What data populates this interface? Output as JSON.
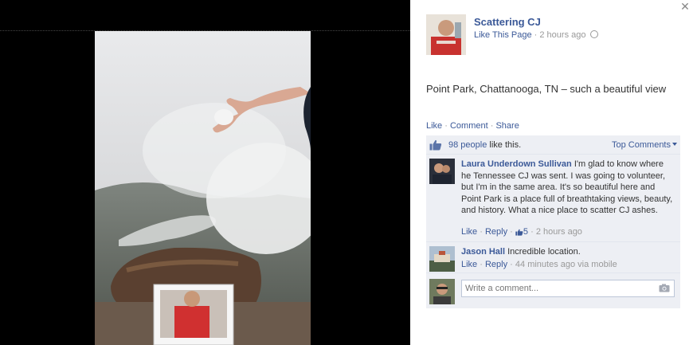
{
  "post": {
    "page_name": "Scattering CJ",
    "like_page_link": "Like This Page",
    "separator": "·",
    "timestamp": "2 hours ago",
    "privacy_icon": "globe-icon",
    "text": "Point Park, Chattanooga, TN – such a beautiful view",
    "actions": {
      "like": "Like",
      "comment": "Comment",
      "share": "Share"
    }
  },
  "likes": {
    "icon": "thumbs-up-icon",
    "count_text": "98 people",
    "suffix": " like this.",
    "sort_label": "Top Comments"
  },
  "comments": [
    {
      "author": "Laura Underdown Sullivan",
      "text": "I'm glad to know where he Tennessee CJ was sent. I was going to volunteer, but I'm in the same area. It's so beautiful here and Point Park is a place full of breathtaking views, beauty, and history. What a nice place to scatter CJ ashes.",
      "like_label": "Like",
      "reply_label": "Reply",
      "like_count": "5",
      "time": "2 hours ago"
    },
    {
      "author": "Jason Hall",
      "text": "Incredible location.",
      "like_label": "Like",
      "reply_label": "Reply",
      "time": "44 minutes ago via mobile"
    }
  ],
  "composer": {
    "placeholder": "Write a comment...",
    "camera_icon": "camera-icon"
  },
  "close_icon": "close-icon",
  "colors": {
    "link": "#3b5998",
    "muted": "#999999",
    "ufi_background": "#edeff4",
    "media_background": "#000000"
  }
}
